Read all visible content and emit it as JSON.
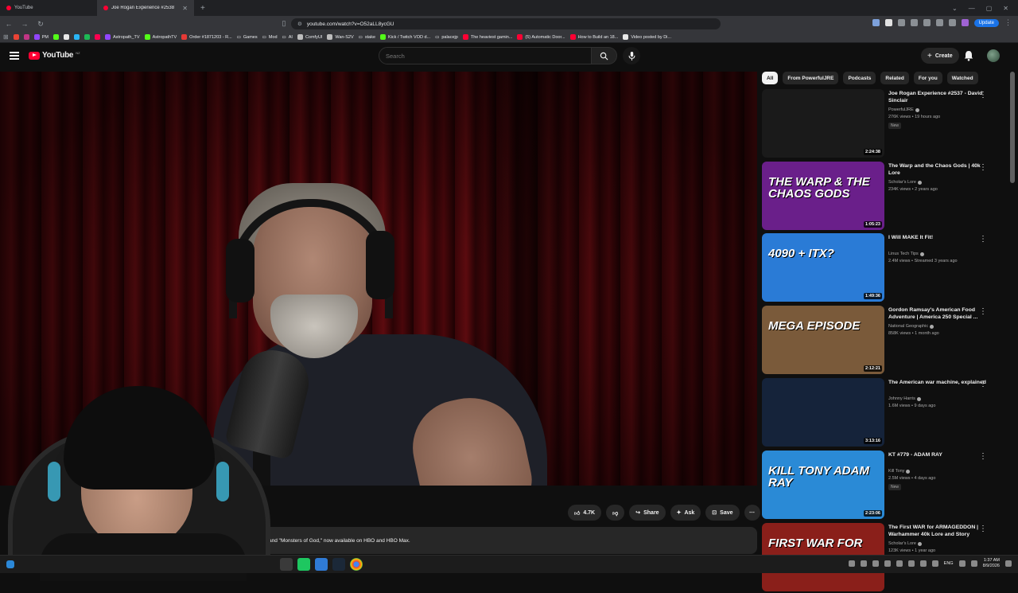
{
  "browser": {
    "tabs": [
      {
        "label": "YouTube",
        "active": false
      },
      {
        "label": "Joe Rogan Experience #2538",
        "active": true
      }
    ],
    "url": "youtube.com/watch?v=O52aLL8ycGU",
    "update_label": "Update",
    "bookmarks": [
      {
        "label": "PM",
        "color": "#ea4335"
      },
      {
        "label": "Astropath_TV",
        "color": "#9146ff"
      },
      {
        "label": "AstropathTV",
        "color": "#53fc18"
      },
      {
        "label": "Order #1871203 - R...",
        "color": "#e53935"
      },
      {
        "label": "Games",
        "color": "#bdbdbd"
      },
      {
        "label": "Mod",
        "color": "#bdbdbd"
      },
      {
        "label": "AI",
        "color": "#bdbdbd"
      },
      {
        "label": "ComfyUI",
        "color": "#bdbdbd"
      },
      {
        "label": "Wan-S2V",
        "color": "#bdbdbd"
      },
      {
        "label": "stake",
        "color": "#bdbdbd"
      },
      {
        "label": "Kick / Twitch VOD d...",
        "color": "#53fc18"
      },
      {
        "label": "palacejp",
        "color": "#bdbdbd"
      },
      {
        "label": "The heaviest gamin...",
        "color": "#ff0033"
      },
      {
        "label": "(5) Automatic Door...",
        "color": "#ff0033"
      },
      {
        "label": "How to Build an 18...",
        "color": "#ff0033"
      },
      {
        "label": "Video posted by Di...",
        "color": "#e8e8e8"
      }
    ]
  },
  "header": {
    "logo_text": "YouTube",
    "logo_country": "NZ",
    "search_placeholder": "Search",
    "create_label": "Create"
  },
  "player": {
    "description_snippet": "and \"Monsters of God,\" now available on HBO and HBO Max."
  },
  "actions": {
    "like_count": "4.7K",
    "share_label": "Share",
    "ask_label": "Ask",
    "save_label": "Save"
  },
  "chips": [
    "All",
    "From PowerfulJRE",
    "Podcasts",
    "Related",
    "For you",
    "Watched"
  ],
  "related": [
    {
      "title": "Joe Rogan Experience #2537 - David Sinclair",
      "channel": "PowerfulJRE",
      "meta": "276K views • 19 hours ago",
      "badge": "New",
      "duration": "2:24:38",
      "thumb_text": "",
      "thumb_bg": "#1a1a1a"
    },
    {
      "title": "The Warp and the Chaos Gods | 40k Lore",
      "channel": "Scholar's Lore",
      "meta": "234K views • 2 years ago",
      "badge": "",
      "duration": "1:05:23",
      "thumb_text": "THE WARP & THE CHAOS GODS",
      "thumb_bg": "#6a1f8a"
    },
    {
      "title": "I Will MAKE It Fit!",
      "channel": "Linus Tech Tips",
      "meta": "2.4M views • Streamed 3 years ago",
      "badge": "",
      "duration": "1:49:36",
      "thumb_text": "4090 + ITX?",
      "thumb_bg": "#2a7bd6"
    },
    {
      "title": "Gordon Ramsay's American Food Adventure | America 250 Special ...",
      "channel": "National Geographic",
      "meta": "858K views • 1 month ago",
      "badge": "",
      "duration": "2:12:21",
      "thumb_text": "MEGA EPISODE",
      "thumb_bg": "#7a5a3a"
    },
    {
      "title": "The American war machine, explained",
      "channel": "Johnny Harris",
      "meta": "1.6M views • 9 days ago",
      "badge": "",
      "duration": "3:13:16",
      "thumb_text": "",
      "thumb_bg": "#15233a"
    },
    {
      "title": "KT #779 - ADAM RAY",
      "channel": "Kill Tony",
      "meta": "2.5M views • 4 days ago",
      "badge": "New",
      "duration": "2:23:06",
      "thumb_text": "KILL TONY ADAM RAY",
      "thumb_bg": "#2a8ad6"
    },
    {
      "title": "The First WAR for ARMAGEDDON | Warhammer 40k Lore and Story",
      "channel": "Scholar's Lore",
      "meta": "123K views • 1 year ago",
      "badge": "",
      "duration": "",
      "thumb_text": "FIRST WAR FOR",
      "thumb_bg": "#8a1f1a"
    }
  ],
  "taskbar": {
    "language": "ENG",
    "time": "1:37 AM",
    "date": "8/9/2026"
  }
}
